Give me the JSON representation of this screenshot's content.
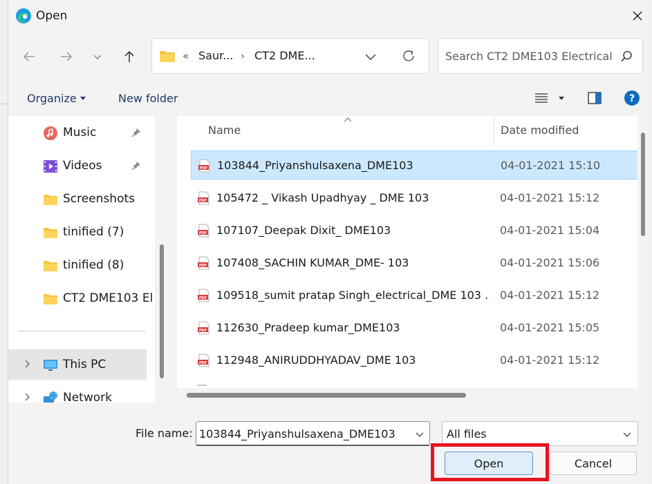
{
  "window": {
    "title": "Open",
    "close_label": "✕"
  },
  "address": {
    "overflow": "«",
    "crumbs": [
      "Saur...",
      "CT2 DME..."
    ],
    "separator": "›"
  },
  "search": {
    "placeholder": "Search CT2 DME103 Electrical"
  },
  "commands": {
    "organize": "Organize",
    "new_folder": "New folder"
  },
  "nav": {
    "items": [
      {
        "label": "Music"
      },
      {
        "label": "Videos"
      },
      {
        "label": "Screenshots"
      },
      {
        "label": "tinified (7)"
      },
      {
        "label": "tinified (8)"
      },
      {
        "label": "CT2 DME103 El"
      },
      {
        "label": "This PC"
      },
      {
        "label": "Network"
      }
    ]
  },
  "columns": {
    "name": "Name",
    "date": "Date modified"
  },
  "files": [
    {
      "name": "103844_Priyanshulsaxena_DME103",
      "date": "04-01-2021 15:10"
    },
    {
      "name": "105472 _ Vikash Upadhyay _ DME 103",
      "date": "04-01-2021 15:12"
    },
    {
      "name": "107107_Deepak Dixit_ DME103",
      "date": "04-01-2021 15:04"
    },
    {
      "name": "107408_SACHIN KUMAR_DME- 103",
      "date": "04-01-2021 15:06"
    },
    {
      "name": "109518_sumit pratap Singh_electrical_DME 103 ...",
      "date": "04-01-2021 15:12"
    },
    {
      "name": "112630_Pradeep kumar_DME103",
      "date": "04-01-2021 15:05"
    },
    {
      "name": "112948_ANIRUDDHYADAV_DME 103",
      "date": "04-01-2021 15:12"
    }
  ],
  "footer": {
    "file_name_label": "File name:",
    "file_name_value": "103844_Priyanshulsaxena_DME103",
    "filter_value": "All files",
    "open_label": "Open",
    "cancel_label": "Cancel"
  },
  "colors": {
    "selection": "#cce8ff",
    "highlight": "#e8131e",
    "accent": "#0f6cbd"
  }
}
